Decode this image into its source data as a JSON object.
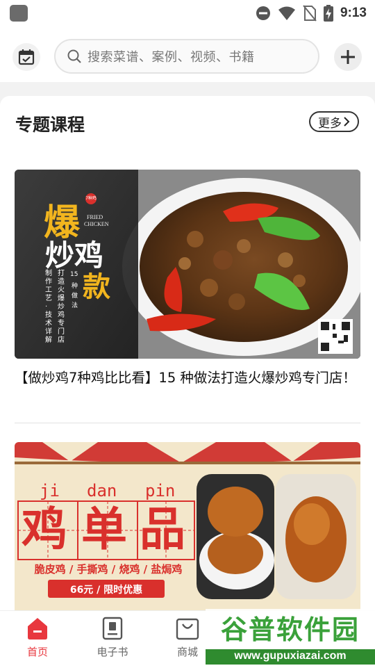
{
  "status_bar": {
    "time": "9:13",
    "icons": [
      "app-icon",
      "dnd-icon",
      "wifi-icon",
      "no-sim-icon",
      "battery-charging-icon"
    ]
  },
  "header": {
    "calendar_icon": "calendar-check-icon",
    "search": {
      "placeholder": "搜索菜谱、案例、视频、书籍"
    },
    "add_icon": "plus-icon"
  },
  "section": {
    "title": "专题课程",
    "more_label": "更多"
  },
  "cards": [
    {
      "banner": {
        "big1": "爆",
        "big2": "炒鸡",
        "big3": "款",
        "seal": "7种鸡",
        "fried": "FRIED",
        "chicken": "CHICKEN",
        "col_num": "15",
        "col_a": "种",
        "col_b": "做",
        "col_c": "法",
        "v1": "打造火爆炒鸡专门店",
        "v2": "制作工艺·技术详解"
      },
      "title": "【做炒鸡7种鸡比比看】15 种做法打造火爆炒鸡专门店！"
    },
    {
      "banner": {
        "pinyin1": "ji",
        "pinyin2": "dan",
        "pinyin3": "pin",
        "char1": "鸡",
        "char2": "单",
        "char3": "品",
        "subtitle": "脆皮鸡 / 手撕鸡 / 烧鸡 / 盐焗鸡",
        "price": "66元 / 限时优惠"
      }
    }
  ],
  "bottom_nav": [
    {
      "label": "首页",
      "icon": "home-icon",
      "active": true
    },
    {
      "label": "电子书",
      "icon": "ebook-icon",
      "active": false
    },
    {
      "label": "商城",
      "icon": "shopping-bag-icon",
      "active": false
    }
  ],
  "watermark": {
    "text": "谷普软件园",
    "url": "www.gupuxiazai.com"
  },
  "colors": {
    "accent": "#e8373e",
    "nav_inactive": "#666666",
    "banner_yellow": "#f2b51e",
    "stamp_red": "#d9302c",
    "watermark_green": "#3aa13a"
  }
}
